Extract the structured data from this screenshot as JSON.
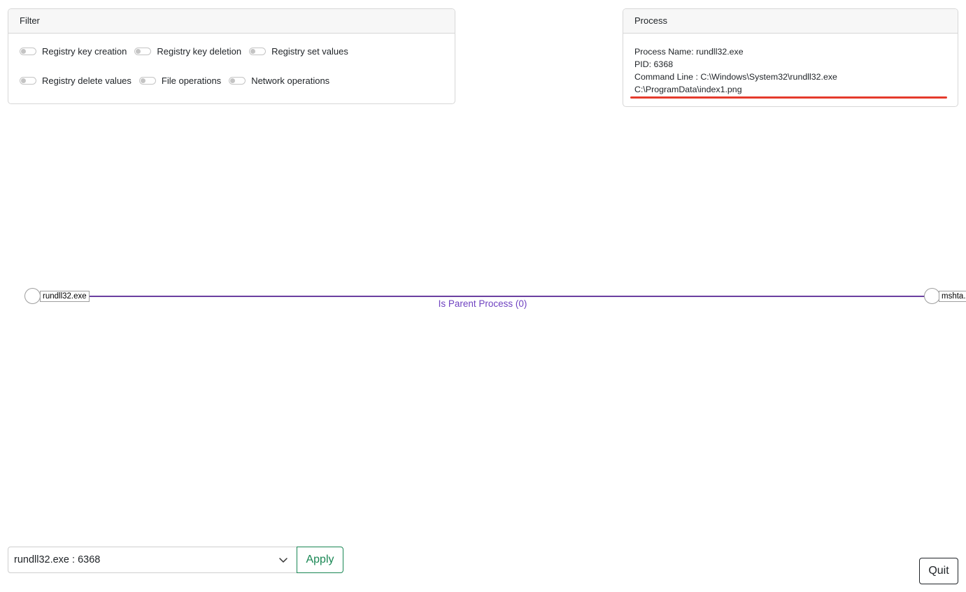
{
  "filter": {
    "title": "Filter",
    "row1": [
      {
        "label": "Registry key creation",
        "checked": false
      },
      {
        "label": "Registry key deletion",
        "checked": false
      },
      {
        "label": "Registry set values",
        "checked": false
      }
    ],
    "row2": [
      {
        "label": "Registry delete values",
        "checked": false
      },
      {
        "label": "File operations",
        "checked": false
      },
      {
        "label": "Network operations",
        "checked": false
      }
    ]
  },
  "process": {
    "title": "Process",
    "name_line": "Process Name: rundll32.exe",
    "pid_line": "PID: 6368",
    "cmd_line": "Command Line : C:\\Windows\\System32\\rundll32.exe",
    "cmd_line_cont": "C:\\ProgramData\\index1.png",
    "highlight_color": "#e53b2c"
  },
  "graph": {
    "source_node": "rundll32.exe",
    "target_node": "mshta.",
    "edge_label": "Is Parent Process (0)",
    "edge_color": "#6b3fa0"
  },
  "controls": {
    "selected_process": "rundll32.exe : 6368",
    "apply_label": "Apply",
    "quit_label": "Quit"
  }
}
